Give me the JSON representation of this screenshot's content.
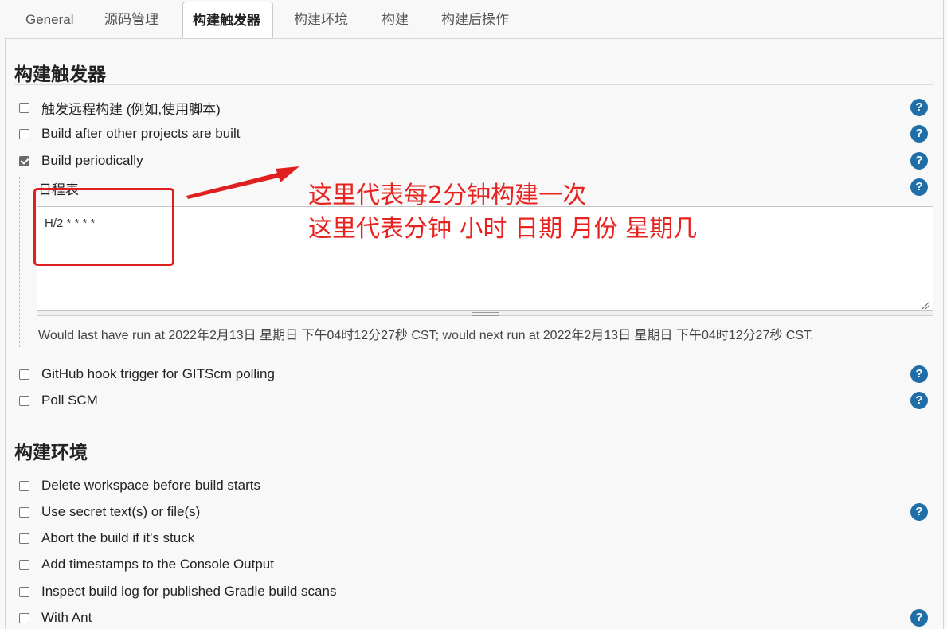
{
  "tabs": [
    {
      "label": "General"
    },
    {
      "label": "源码管理"
    },
    {
      "label": "构建触发器"
    },
    {
      "label": "构建环境"
    },
    {
      "label": "构建"
    },
    {
      "label": "构建后操作"
    }
  ],
  "triggers": {
    "title": "构建触发器",
    "items": [
      {
        "label": "触发远程构建 (例如,使用脚本)",
        "checked": false
      },
      {
        "label": "Build after other projects are built",
        "checked": false
      },
      {
        "label": "Build periodically",
        "checked": true
      },
      {
        "label": "GitHub hook trigger for GITScm polling",
        "checked": false
      },
      {
        "label": "Poll SCM",
        "checked": false
      }
    ],
    "schedule_label": "日程表",
    "schedule_value": "H/2 * * * *",
    "run_info": "Would last have run at 2022年2月13日 星期日 下午04时12分27秒 CST; would next run at 2022年2月13日 星期日 下午04时12分27秒 CST."
  },
  "environment": {
    "title": "构建环境",
    "items": [
      {
        "label": "Delete workspace before build starts",
        "checked": false
      },
      {
        "label": "Use secret text(s) or file(s)",
        "checked": false
      },
      {
        "label": "Abort the build if it's stuck",
        "checked": false
      },
      {
        "label": "Add timestamps to the Console Output",
        "checked": false
      },
      {
        "label": "Inspect build log for published Gradle build scans",
        "checked": false
      },
      {
        "label": "With Ant",
        "checked": false
      }
    ]
  },
  "help_icon_text": "?",
  "annotation": {
    "line1": "这里代表每2分钟构建一次",
    "line2": "这里代表分钟 小时 日期 月份 星期几",
    "color": "#e8231f"
  },
  "colors": {
    "help_blue": "#1f6ea8",
    "annotation_red": "#e02020"
  }
}
